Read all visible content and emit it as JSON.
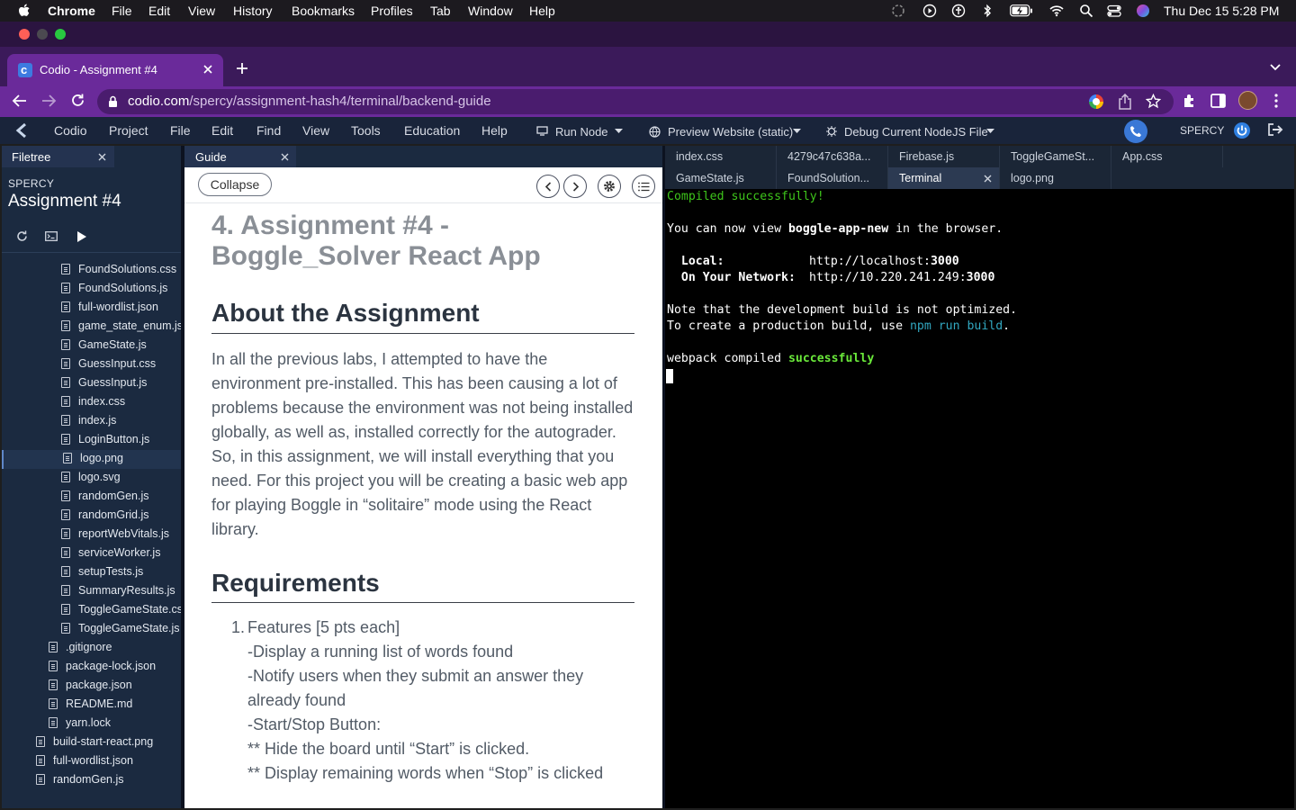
{
  "os_menubar": {
    "app": "Chrome",
    "items": [
      "File",
      "Edit",
      "View",
      "History",
      "Bookmarks",
      "Profiles",
      "Tab",
      "Window",
      "Help"
    ],
    "clock": "Thu Dec 15  5:28 PM"
  },
  "browser": {
    "tab_title": "Codio - Assignment #4",
    "url_domain": "codio.com",
    "url_path": "/spercy/assignment-hash4/terminal/backend-guide"
  },
  "codio_bar": {
    "menus": [
      "Codio",
      "Project",
      "File",
      "Edit",
      "Find",
      "View",
      "Tools",
      "Education",
      "Help"
    ],
    "run_node": "Run Node",
    "preview": "Preview Website (static)",
    "debug": "Debug Current NodeJS File",
    "user": "SPERCY"
  },
  "filetree": {
    "tab": "Filetree",
    "owner": "SPERCY",
    "project": "Assignment #4",
    "files": [
      {
        "name": "FoundSolutions.css",
        "depth": 2
      },
      {
        "name": "FoundSolutions.js",
        "depth": 2
      },
      {
        "name": "full-wordlist.json",
        "depth": 2
      },
      {
        "name": "game_state_enum.js",
        "depth": 2
      },
      {
        "name": "GameState.js",
        "depth": 2
      },
      {
        "name": "GuessInput.css",
        "depth": 2
      },
      {
        "name": "GuessInput.js",
        "depth": 2
      },
      {
        "name": "index.css",
        "depth": 2
      },
      {
        "name": "index.js",
        "depth": 2
      },
      {
        "name": "LoginButton.js",
        "depth": 2
      },
      {
        "name": "logo.png",
        "depth": 2,
        "selected": true
      },
      {
        "name": "logo.svg",
        "depth": 2
      },
      {
        "name": "randomGen.js",
        "depth": 2
      },
      {
        "name": "randomGrid.js",
        "depth": 2
      },
      {
        "name": "reportWebVitals.js",
        "depth": 2
      },
      {
        "name": "serviceWorker.js",
        "depth": 2
      },
      {
        "name": "setupTests.js",
        "depth": 2
      },
      {
        "name": "SummaryResults.js",
        "depth": 2
      },
      {
        "name": "ToggleGameState.css",
        "depth": 2
      },
      {
        "name": "ToggleGameState.js",
        "depth": 2
      },
      {
        "name": ".gitignore",
        "depth": 1
      },
      {
        "name": "package-lock.json",
        "depth": 1
      },
      {
        "name": "package.json",
        "depth": 1
      },
      {
        "name": "README.md",
        "depth": 1
      },
      {
        "name": "yarn.lock",
        "depth": 1
      },
      {
        "name": "build-start-react.png",
        "depth": 0
      },
      {
        "name": "full-wordlist.json",
        "depth": 0
      },
      {
        "name": "randomGen.js",
        "depth": 0
      }
    ]
  },
  "guide": {
    "tab": "Guide",
    "collapse": "Collapse",
    "title_line1": "4. Assignment #4 -",
    "title_line2": "Boggle_Solver React App",
    "about_heading": "About the Assignment",
    "about_lines": [
      "In all the previous labs, I attempted to have the",
      "environment pre-installed. This has been causing a lot of",
      "problems because the environment was not being installed",
      "globally, as well as, installed correctly for the autograder.",
      "So, in this assignment, we will install everything that you",
      "need. For this project you will be creating a basic web app",
      "for playing Boggle in “solitaire” mode using the React",
      "library."
    ],
    "req_heading": "Requirements",
    "req_number": "1.",
    "req_lines": [
      "Features [5 pts each]",
      "-Display a running list of words found",
      "-Notify users when they submit an answer they",
      "already found",
      "-Start/Stop Button:",
      "** Hide the board until “Start” is clicked.",
      "** Display remaining words when “Stop” is clicked"
    ]
  },
  "editor_tabs": {
    "row1": [
      "index.css",
      "4279c47c638a...",
      "Firebase.js",
      "ToggleGameSt...",
      "App.css"
    ],
    "row2": [
      "GameState.js",
      "FoundSolution...",
      "Terminal",
      "logo.png"
    ],
    "active": "Terminal"
  },
  "terminal": {
    "compiled": "Compiled successfully!",
    "view_prefix": "You can now view ",
    "app_name": "boggle-app-new",
    "view_suffix": " in the browser.",
    "local_label": "  Local:",
    "local_url_prefix": "http://localhost:",
    "local_port": "3000",
    "network_label": "  On Your Network:",
    "network_url_prefix": "http://10.220.241.249:",
    "network_port": "3000",
    "note": "Note that the development build is not optimized.",
    "create_prefix": "To create a production build, use ",
    "create_cmd": "npm run build",
    "create_suffix": ".",
    "webpack_prefix": "webpack compiled ",
    "webpack_status": "successfully"
  },
  "colors": {
    "chrome_purple": "#6a2a9a",
    "codio_bar": "#19243a",
    "terminal_green": "#3ec51b",
    "terminal_cyan": "#32a8c1",
    "terminal_bright_green": "#6ae83a"
  }
}
